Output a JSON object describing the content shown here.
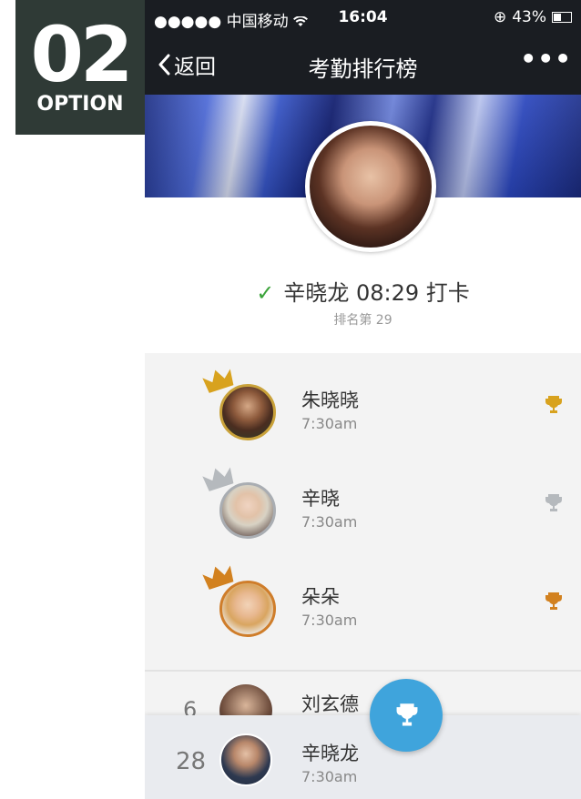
{
  "badge": {
    "number": "02",
    "label": "OPTION"
  },
  "status": {
    "carrier": "●●●●● 中国移动",
    "time": "16:04",
    "battery": "43%"
  },
  "nav": {
    "back_label": "返回",
    "title": "考勤排行榜",
    "more_label": "•••"
  },
  "checkin": {
    "text": "辛晓龙 08:29 打卡",
    "rank_text": "排名第 29"
  },
  "top3": [
    {
      "name": "朱晓晓",
      "time": "7:30am",
      "medal": "gold",
      "medal_color": "#d8a21e",
      "border_color": "#c9a23a"
    },
    {
      "name": "辛晓",
      "time": "7:30am",
      "medal": "silver",
      "medal_color": "#b5b9bd",
      "border_color": "#a9adb2"
    },
    {
      "name": "朵朵",
      "time": "7:30am",
      "medal": "bronze",
      "medal_color": "#d2811f",
      "border_color": "#cf7d2a"
    }
  ],
  "partial_row": {
    "rank": "6",
    "name": "刘玄德"
  },
  "my_row": {
    "rank": "28",
    "name": "辛晓龙",
    "time": "7:30am"
  },
  "colors": {
    "accent": "#3fa4dc",
    "check": "#3ba33a",
    "nav_bg": "#1a1d22"
  }
}
